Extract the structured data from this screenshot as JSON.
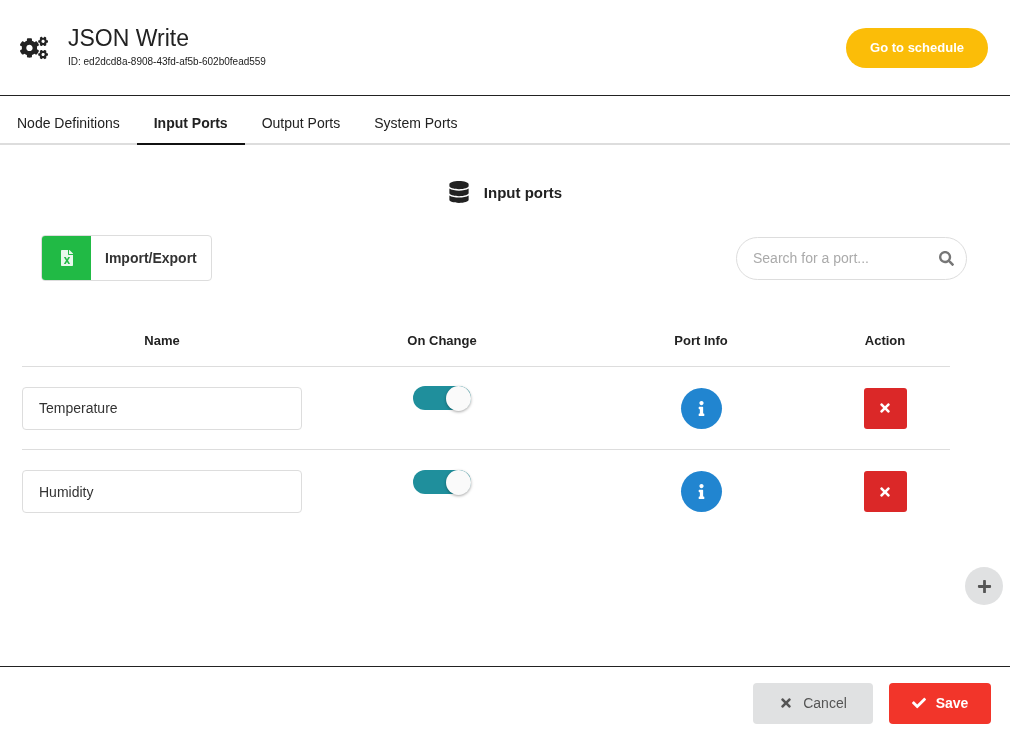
{
  "header": {
    "title": "JSON Write",
    "id": "ID: ed2dcd8a-8908-43fd-af5b-602b0fead559",
    "schedule_button": "Go to schedule"
  },
  "tabs": [
    {
      "label": "Node Definitions",
      "selected": false
    },
    {
      "label": "Input Ports",
      "selected": true
    },
    {
      "label": "Output Ports",
      "selected": false
    },
    {
      "label": "System Ports",
      "selected": false
    }
  ],
  "section_title": "Input ports",
  "import_export": "Import/Export",
  "search": {
    "placeholder": "Search for a port..."
  },
  "table": {
    "columns": [
      "Name",
      "On Change",
      "Port Info",
      "Action"
    ],
    "rows": [
      {
        "name": "Temperature",
        "on_change": true
      },
      {
        "name": "Humidity",
        "on_change": true
      }
    ]
  },
  "footer": {
    "cancel": "Cancel",
    "save": "Save"
  }
}
